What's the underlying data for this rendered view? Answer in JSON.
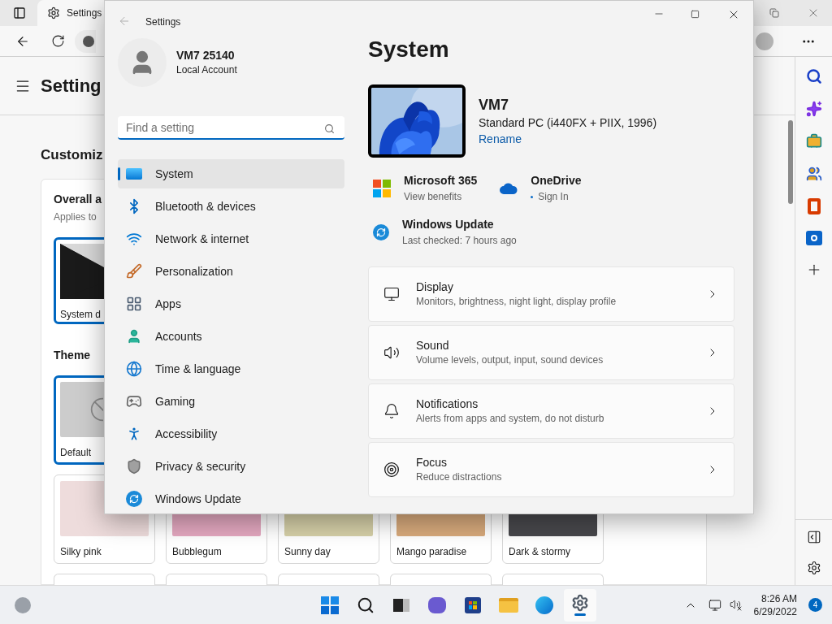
{
  "browser": {
    "tab": {
      "title": "Settings"
    },
    "page_heading": "Setting",
    "section_heading": "Customiz",
    "card": {
      "title": "Overall a",
      "subtitle": "Applies to"
    },
    "mode_tile": {
      "label": "System d",
      "selected": true
    },
    "theme_heading": "Theme",
    "themes": [
      {
        "label": "Default",
        "selected": true,
        "color": "#cccccc"
      },
      {
        "label": "Silky pink",
        "selected": false,
        "color": "#eedcdc"
      },
      {
        "label": "Bubblegum",
        "selected": false,
        "color": "#e4a8c0"
      },
      {
        "label": "Sunny day",
        "selected": false,
        "color": "#d6d0a8"
      },
      {
        "label": "Mango paradise",
        "selected": false,
        "color": "#d8aa7c"
      },
      {
        "label": "Dark & stormy",
        "selected": false,
        "color": "#48484c"
      }
    ]
  },
  "settings_window": {
    "title": "Settings",
    "account": {
      "name": "VM7 25140",
      "type": "Local Account"
    },
    "search": {
      "placeholder": "Find a setting"
    },
    "nav": [
      {
        "label": "System",
        "selected": true
      },
      {
        "label": "Bluetooth & devices",
        "selected": false
      },
      {
        "label": "Network & internet",
        "selected": false
      },
      {
        "label": "Personalization",
        "selected": false
      },
      {
        "label": "Apps",
        "selected": false
      },
      {
        "label": "Accounts",
        "selected": false
      },
      {
        "label": "Time & language",
        "selected": false
      },
      {
        "label": "Gaming",
        "selected": false
      },
      {
        "label": "Accessibility",
        "selected": false
      },
      {
        "label": "Privacy & security",
        "selected": false
      },
      {
        "label": "Windows Update",
        "selected": false
      }
    ],
    "page_title": "System",
    "device": {
      "name": "VM7",
      "model": "Standard PC (i440FX + PIIX, 1996)",
      "rename": "Rename"
    },
    "quick_links": [
      {
        "title": "Microsoft 365",
        "subtitle": "View benefits"
      },
      {
        "title": "OneDrive",
        "subtitle": "Sign In"
      },
      {
        "title": "Windows Update",
        "subtitle": "Last checked: 7 hours ago"
      }
    ],
    "cards": [
      {
        "title": "Display",
        "subtitle": "Monitors, brightness, night light, display profile"
      },
      {
        "title": "Sound",
        "subtitle": "Volume levels, output, input, sound devices"
      },
      {
        "title": "Notifications",
        "subtitle": "Alerts from apps and system, do not disturb"
      },
      {
        "title": "Focus",
        "subtitle": "Reduce distractions"
      }
    ]
  },
  "taskbar": {
    "time": "8:26 AM",
    "date": "6/29/2022",
    "notification_count": "4"
  }
}
